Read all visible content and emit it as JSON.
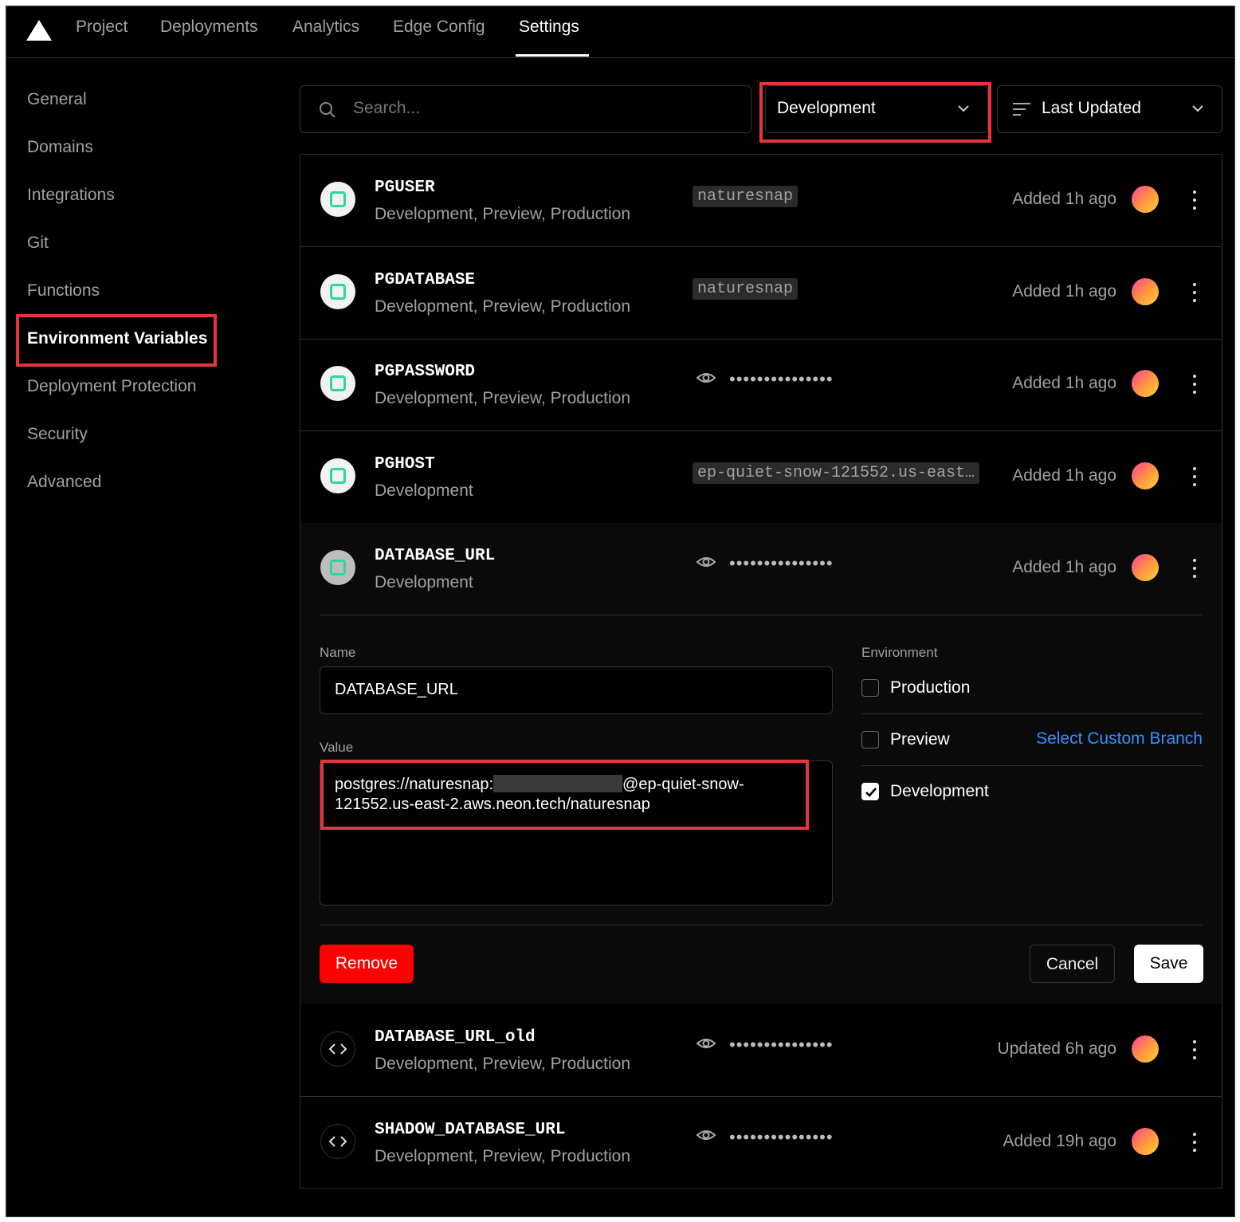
{
  "nav": {
    "logo": "vercel-logo",
    "tabs": [
      "Project",
      "Deployments",
      "Analytics",
      "Edge Config",
      "Settings"
    ],
    "active_tab": "Settings"
  },
  "sidebar": {
    "items": [
      "General",
      "Domains",
      "Integrations",
      "Git",
      "Functions",
      "Environment Variables",
      "Deployment Protection",
      "Security",
      "Advanced"
    ],
    "active_item": "Environment Variables"
  },
  "toolbar": {
    "search_placeholder": "Search...",
    "environment_filter": "Development",
    "sort": "Last Updated"
  },
  "variables": [
    {
      "name": "PGUSER",
      "environments": "Development, Preview, Production",
      "value": "naturesnap",
      "hidden": false,
      "time": "Added 1h ago",
      "icon": "neon-icon"
    },
    {
      "name": "PGDATABASE",
      "environments": "Development, Preview, Production",
      "value": "naturesnap",
      "hidden": false,
      "time": "Added 1h ago",
      "icon": "neon-icon"
    },
    {
      "name": "PGPASSWORD",
      "environments": "Development, Preview, Production",
      "value": "•••••••••••••••",
      "hidden": true,
      "time": "Added 1h ago",
      "icon": "neon-icon"
    },
    {
      "name": "PGHOST",
      "environments": "Development",
      "value": "ep-quiet-snow-121552.us-east…",
      "hidden": false,
      "time": "Added 1h ago",
      "icon": "neon-icon"
    },
    {
      "name": "DATABASE_URL",
      "environments": "Development",
      "value": "•••••••••••••••",
      "hidden": true,
      "time": "Added 1h ago",
      "icon": "neon-icon"
    }
  ],
  "editor": {
    "name_label": "Name",
    "name_value": "DATABASE_URL",
    "value_label": "Value",
    "value_line1_prefix": "postgres://naturesnap:",
    "value_line1_suffix": "@ep-quiet-snow-",
    "value_line2": "121552.us-east-2.aws.neon.tech/naturesnap",
    "environment_label": "Environment",
    "env_production": "Production",
    "env_preview": "Preview",
    "env_development": "Development",
    "select_branch": "Select Custom Branch",
    "production_checked": false,
    "preview_checked": false,
    "development_checked": true,
    "remove": "Remove",
    "cancel": "Cancel",
    "save": "Save"
  },
  "variables_after": [
    {
      "name": "DATABASE_URL_old",
      "environments": "Development, Preview, Production",
      "value": "•••••••••••••••",
      "hidden": true,
      "time": "Updated 6h ago",
      "icon": "code-icon"
    },
    {
      "name": "SHADOW_DATABASE_URL",
      "environments": "Development, Preview, Production",
      "value": "•••••••••••••••",
      "hidden": true,
      "time": "Added 19h ago",
      "icon": "code-icon"
    }
  ],
  "colors": {
    "highlight": "#e5343d",
    "remove_button": "#ff0000",
    "link": "#3291ff",
    "neon_accent": "#2bd89a"
  }
}
